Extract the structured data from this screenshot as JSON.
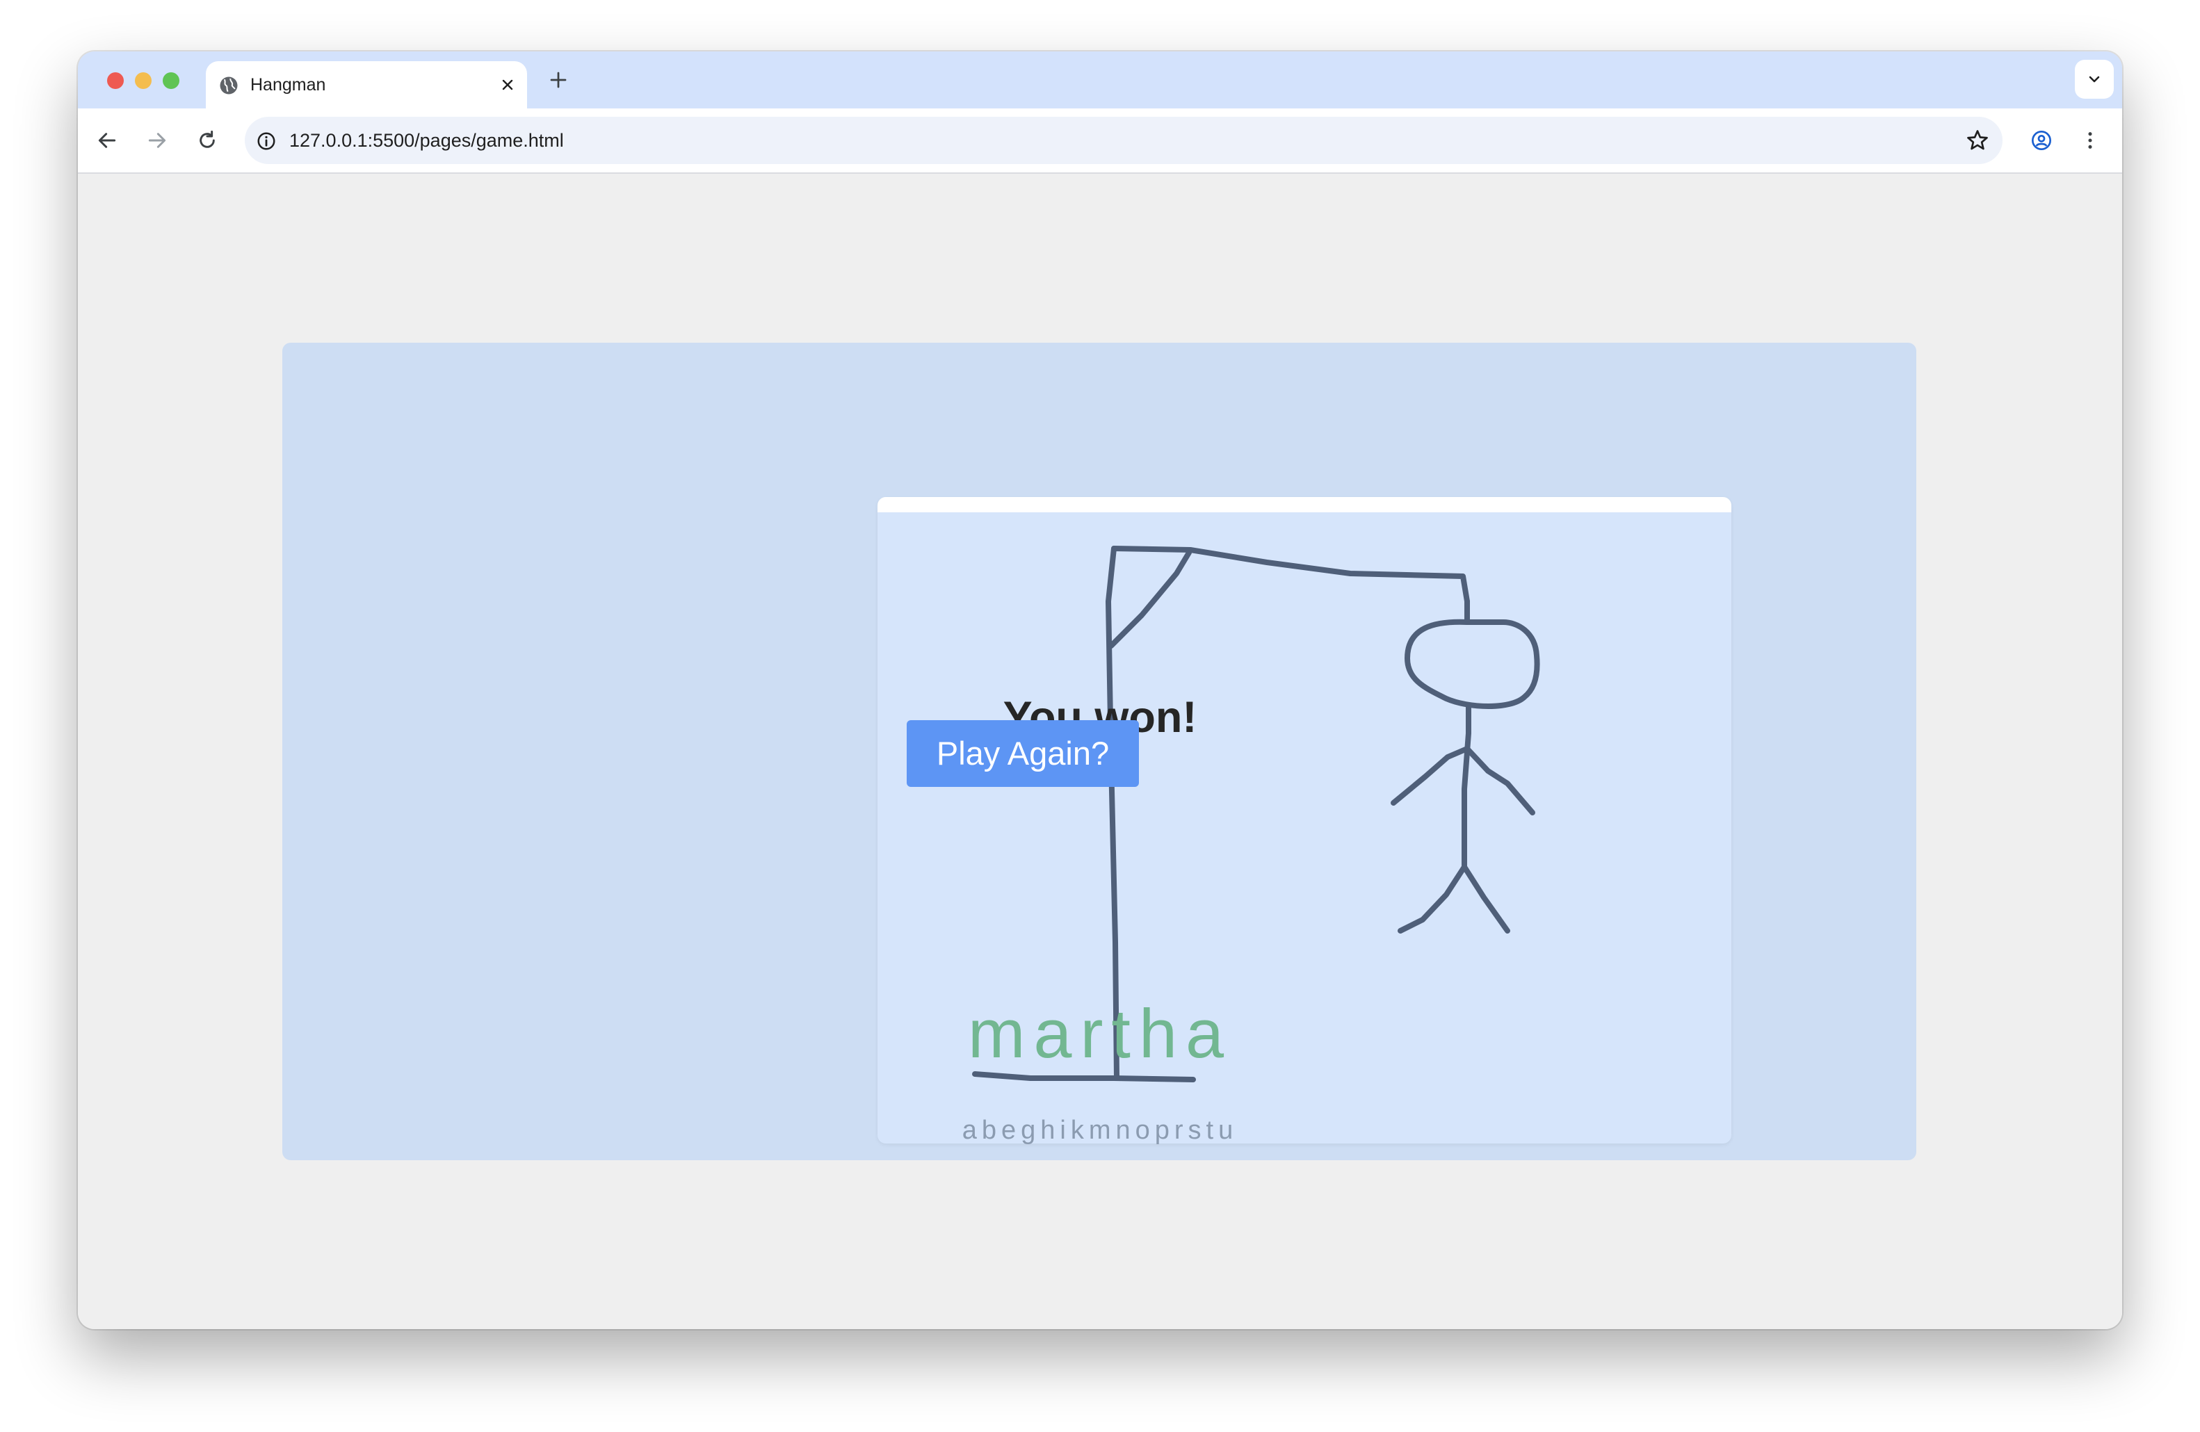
{
  "browser": {
    "tab": {
      "title": "Hangman",
      "favicon": "globe-icon"
    },
    "address_bar": {
      "url": "127.0.0.1:5500/pages/game.html"
    },
    "toolbar_icons": [
      "back-arrow-icon",
      "forward-arrow-icon",
      "reload-icon",
      "site-info-icon",
      "bookmark-star-icon",
      "profile-icon",
      "more-menu-icon"
    ]
  },
  "game": {
    "result_message": "You won!",
    "play_again_label": "Play Again?",
    "word": "martha",
    "guessed_letters": "abeghikmnoprstu",
    "colors": {
      "panel": "#cdddf3",
      "canvas": "#d6e5fb",
      "drawing_stroke": "#4f5f79",
      "button": "#5d95f4",
      "word": "#72b791",
      "guessed": "#8b9bb0"
    }
  }
}
